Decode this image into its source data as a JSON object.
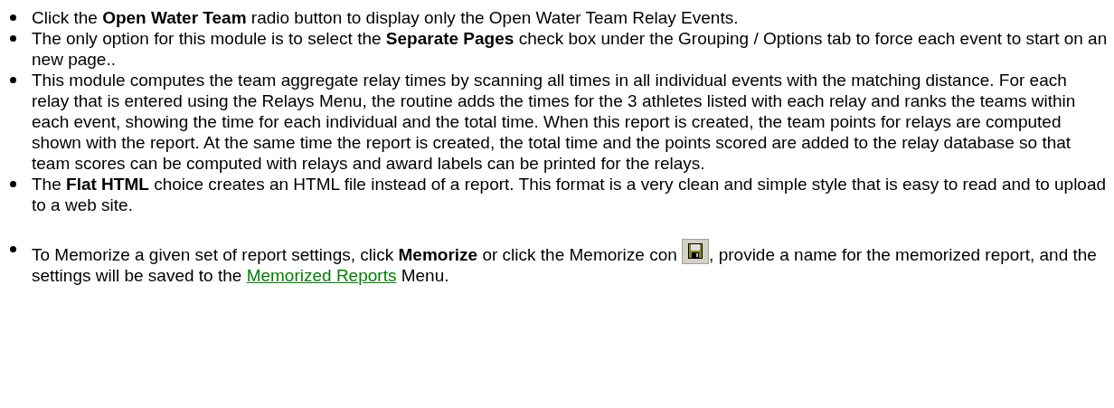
{
  "bullets": [
    {
      "parts": [
        {
          "kind": "text",
          "text": "Click the **Open Water Team** radio button to display only the Open Water Team Relay Events."
        }
      ]
    },
    {
      "parts": [
        {
          "kind": "text",
          "text": "The only option for this module is to select the **Separate Pages** check box under the Grouping / Options tab to force each event to start on an new page.."
        }
      ]
    },
    {
      "parts": [
        {
          "kind": "text",
          "text": "This module computes the team aggregate relay times by scanning all times in all individual events with the matching distance.  For each relay that is entered using the Relays Menu, the routine adds the times for the 3 athletes listed with each relay and ranks the teams within each event, showing the time for each individual and the total time. When this report is created, the team points for relays are computed shown with the report. At the same time the report is created, the total time and the points scored are added to the relay database so that team scores can be computed with relays and award labels can be printed for the relays."
        }
      ]
    },
    {
      "parts": [
        {
          "kind": "text",
          "text": "The **Flat HTML** choice creates an HTML file instead of a report. This format is a very clean and simple style that is easy to read and to upload to a web site."
        }
      ]
    },
    {
      "parts": [
        {
          "kind": "text",
          "text": "To Memorize a given set of report settings, click **Memorize** or click the Memorize con "
        },
        {
          "kind": "icon"
        },
        {
          "kind": "text",
          "text": ", provide a name for the memorized report, and the settings will be saved to the "
        },
        {
          "kind": "link",
          "text": "Memorized Reports"
        },
        {
          "kind": "text",
          "text": " Menu."
        }
      ]
    }
  ]
}
